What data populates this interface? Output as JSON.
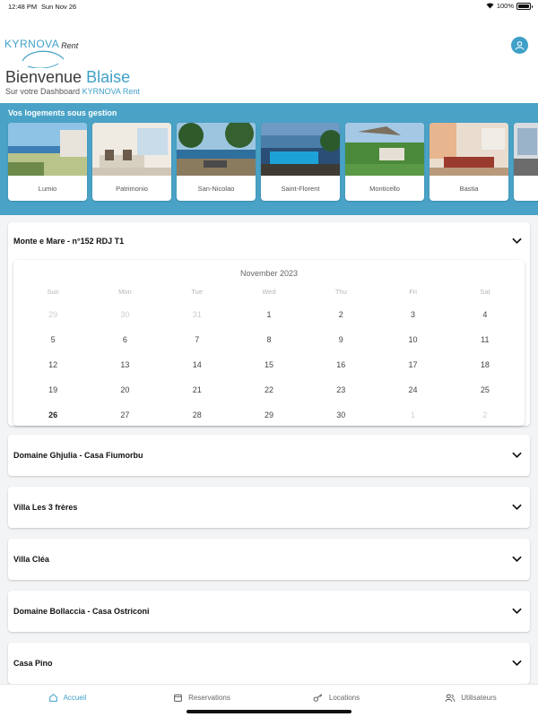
{
  "status_bar": {
    "time": "12:48 PM",
    "date": "Sun Nov 26",
    "battery": "100%",
    "battery_level": 1.0
  },
  "header": {
    "logo_main": "KYRNOVA",
    "logo_sub": "Rent",
    "welcome": "Bienvenue",
    "user_name": "Blaise",
    "subtitle": "Sur votre Dashboard",
    "subtitle_brand": "KYRNOVA Rent",
    "accent_color": "#3fa0c8"
  },
  "properties": {
    "title": "Vos logements sous gestion",
    "items": [
      {
        "label": "Lumio"
      },
      {
        "label": "Patrimonio"
      },
      {
        "label": "San-Nicolao"
      },
      {
        "label": "Saint-Florent"
      },
      {
        "label": "Monticello"
      },
      {
        "label": "Bastia"
      }
    ]
  },
  "open_accordion": {
    "title": "Monte e Mare - n°152 RDJ T1",
    "calendar": {
      "month": "November 2023",
      "weekdays": [
        "Sun",
        "Mon",
        "Tue",
        "Wed",
        "Thu",
        "Fri",
        "Sat"
      ],
      "days": [
        "29",
        "30",
        "31",
        "1",
        "2",
        "3",
        "4",
        "5",
        "6",
        "7",
        "8",
        "9",
        "10",
        "11",
        "12",
        "13",
        "14",
        "15",
        "16",
        "17",
        "18",
        "19",
        "20",
        "21",
        "22",
        "23",
        "24",
        "25",
        "26",
        "27",
        "28",
        "29",
        "30",
        "1",
        "2"
      ],
      "muted": [
        0,
        1,
        2,
        33,
        34
      ],
      "today_index": 28
    }
  },
  "accordions": [
    {
      "title": "Domaine Ghjulia - Casa Fiumorbu"
    },
    {
      "title": "Villa Les 3 frères"
    },
    {
      "title": "Villa Cléa"
    },
    {
      "title": "Domaine Bollaccia - Casa Ostriconi"
    },
    {
      "title": "Casa Pino"
    }
  ],
  "nav": {
    "items": [
      {
        "label": "Accueil",
        "icon": "home-icon"
      },
      {
        "label": "Reservations",
        "icon": "calendar-icon"
      },
      {
        "label": "Locations",
        "icon": "key-icon"
      },
      {
        "label": "Utilisateurs",
        "icon": "users-icon"
      }
    ]
  }
}
